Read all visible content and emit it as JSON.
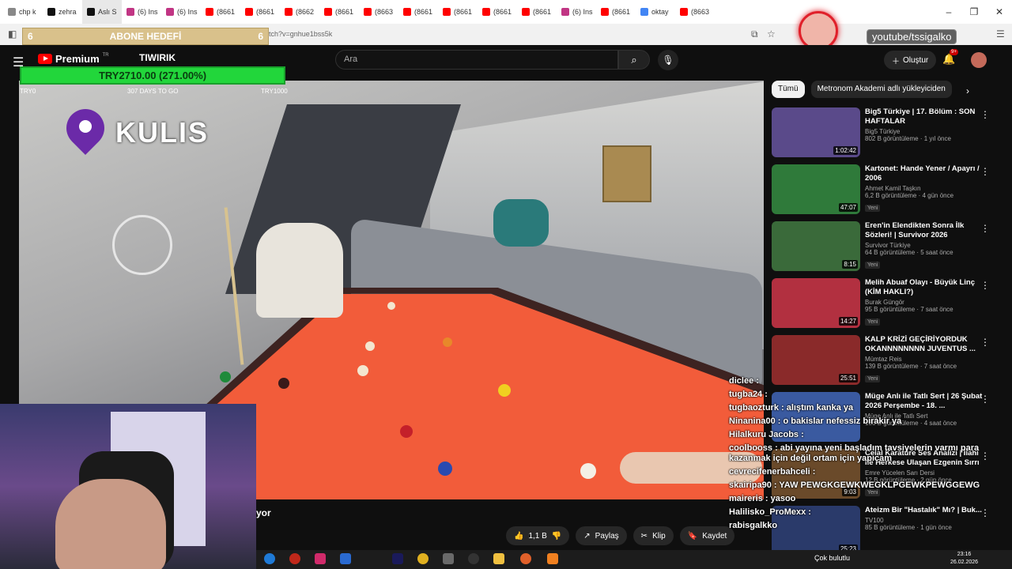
{
  "browser": {
    "tabs": [
      "chp k",
      "zehra",
      "Aslı S",
      "(6) Ins",
      "(6) Ins",
      "(8661",
      "(8661",
      "(8662",
      "(8661",
      "(8663",
      "(8661",
      "(8661",
      "(8661",
      "(8661",
      "(6) Ins",
      "(8661",
      "oktay",
      "(8663"
    ],
    "url": "tch?v=gnhue1bss5k"
  },
  "overlay": {
    "goal": {
      "left": "6",
      "title": "ABONE HEDEFİ",
      "right": "6"
    },
    "donation": {
      "amount": "TRY2710.00 (271.00%)",
      "min": "TRY0",
      "days": "307 DAYS TO GO",
      "max": "TRY1000"
    },
    "kulis": "KULIS",
    "handle": "youtube/tssigalko"
  },
  "header": {
    "brand": "Premium",
    "region": "TR",
    "channel": "TIWIRIK",
    "search_placeholder": "Ara",
    "create_label": "Oluştur",
    "notif_badge": "9+"
  },
  "video": {
    "subtitle_fragment": "yor",
    "likes": "1,1 B",
    "share": "Paylaş",
    "clip": "Klip",
    "save": "Kaydet"
  },
  "chips": [
    "Tümü",
    "Metronom Akademi adlı yükleyiciden"
  ],
  "recommendations": [
    {
      "title": "Big5 Türkiye | 17. Bölüm : SON HAFTALAR",
      "channel": "Big5 Türkiye",
      "views": "802 B görüntüleme · 1 yıl önce",
      "duration": "1:02:42",
      "new": "",
      "color": "#5a4a8a"
    },
    {
      "title": "Kartonet: Hande Yener / Apayrı / 2006",
      "channel": "Ahmet Kamil Taşkın",
      "views": "6,2 B görüntüleme · 4 gün önce",
      "duration": "47:07",
      "new": "Yeni",
      "color": "#2f7a3a"
    },
    {
      "title": "Eren'in Elendikten Sonra İlk Sözleri! | Survivor 2026",
      "channel": "Survivor Türkiye",
      "views": "64 B görüntüleme · 5 saat önce",
      "duration": "8:15",
      "new": "Yeni",
      "color": "#3a6a3a"
    },
    {
      "title": "Melih Abuaf Olayı - Büyük Linç (KİM HAKLI?)",
      "channel": "Burak Güngör",
      "views": "95 B görüntüleme · 7 saat önce",
      "duration": "14:27",
      "new": "Yeni",
      "color": "#b23040"
    },
    {
      "title": "KALP KRİZİ GEÇİRİYORDUK OKANNNNNNNN JUVENTUS ...",
      "channel": "Mümtaz Reis",
      "views": "139 B görüntüleme · 7 saat önce",
      "duration": "25:51",
      "new": "Yeni",
      "color": "#8a2a2a"
    },
    {
      "title": "Müge Anlı ile Tatlı Sert | 26 Şubat 2026 Perşembe - 18. ...",
      "channel": "Müge Anlı ile Tatlı Sert",
      "views": "186 B görüntüleme · 4 saat önce",
      "duration": "",
      "new": "",
      "color": "#3a5aa0"
    },
    {
      "title": "Celal Karatüre Ses Analizi | İlahi ile Herkese Ulaşan Ezgenin Sırrı",
      "channel": "Emre Yücelen Sarı Dersi",
      "views": "12 B görüntüleme · 2 gün önce",
      "duration": "9:03",
      "new": "Yeni",
      "color": "#6a4a2a"
    },
    {
      "title": "Ateizm Bir \"Hastalık\" Mı? | Buk...",
      "channel": "TV100",
      "views": "85 B görüntüleme · 1 gün önce",
      "duration": "25:23",
      "new": "",
      "color": "#2a3a6a"
    }
  ],
  "chat": [
    {
      "user": "diclee",
      "text": ":"
    },
    {
      "user": "tugba24",
      "text": ":"
    },
    {
      "user": "tugbaozturk",
      "text": ": alıştım kanka ya"
    },
    {
      "user": "Ninanina00",
      "text": ": o bakislar nefessiz birakir ya"
    },
    {
      "user": "Hilalkuru Jacobs",
      "text": ":"
    },
    {
      "user": "coolbooss",
      "text": ": abi yayına yeni başladım tavsiyelerin varmı para kazanmak için değil ortam için yapıcam"
    },
    {
      "user": "cevrecifenerbahceli",
      "text": ":"
    },
    {
      "user": "skairipa90",
      "text": ": YAW PEWGKGEWKWEGKLPGEWKPEWGGEWG"
    },
    {
      "user": "maireris",
      "text": ": yasoo"
    },
    {
      "user": "Halilisko_ProMexx",
      "text": ":"
    },
    {
      "user": "rabisgalkko",
      "text": ""
    }
  ],
  "system": {
    "weather": "Çok bulutlu",
    "time": "23:16",
    "date": "26.02.2026"
  }
}
